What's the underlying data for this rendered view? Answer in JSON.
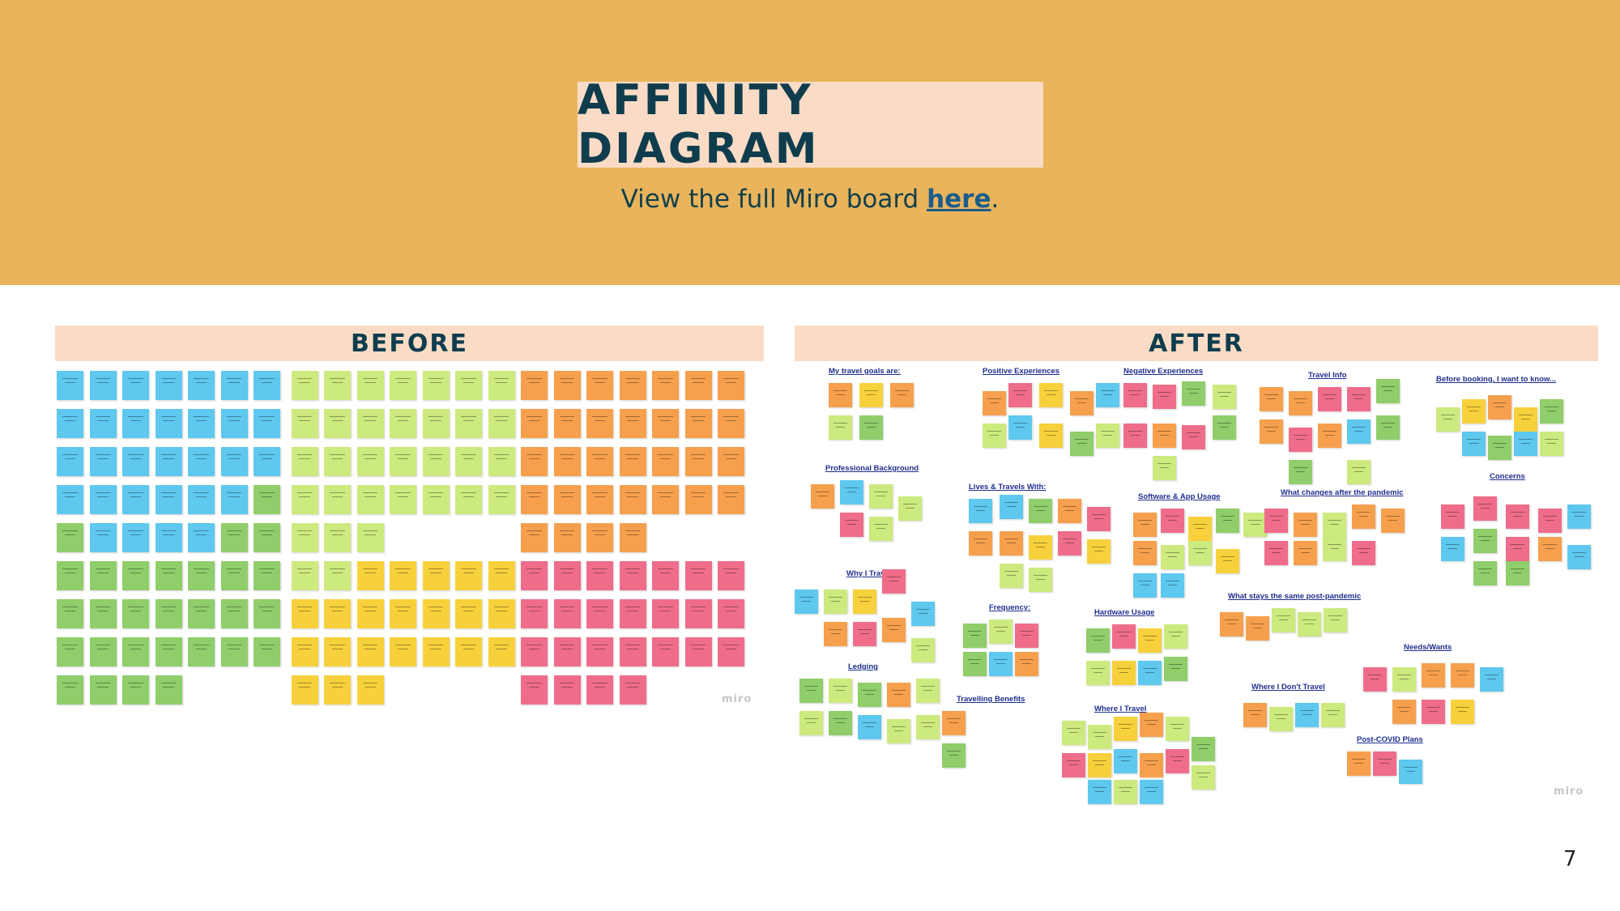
{
  "slide": {
    "title": "AFFINITY DIAGRAM",
    "subtitle_prefix": "View the full Miro board ",
    "subtitle_link": "here",
    "subtitle_suffix": ".",
    "page_number": "7"
  },
  "before": {
    "label": "BEFORE",
    "watermark": "miro"
  },
  "after": {
    "label": "AFTER",
    "watermark": "miro",
    "clusters": [
      "My travel goals are:",
      "Positive Experiences",
      "Negative Experiences",
      "Travel Info",
      "Before booking, I want to know...",
      "Professional Background",
      "Lives & Travels With:",
      "Software & App Usage",
      "What changes after the pandemic",
      "Concerns",
      "Why I Travel",
      "Frequency:",
      "Hardware Usage",
      "What stays the same post-pandemic",
      "Ledging",
      "Needs/Wants",
      "Travelling Benefits",
      "Where I Travel",
      "Where I Don't Travel",
      "Post-COVID Plans"
    ]
  },
  "colors": {
    "header": "#e9b45c",
    "label_bar": "#fadcc6",
    "title_text": "#0f3d4d",
    "link": "#1a5d8c",
    "note_blue": "#5ec8ef",
    "note_green": "#8fce6a",
    "note_lightgreen": "#cdea7e",
    "note_yellow": "#f7d13c",
    "note_orange": "#f6a04d",
    "note_pink": "#ef6d8a"
  }
}
